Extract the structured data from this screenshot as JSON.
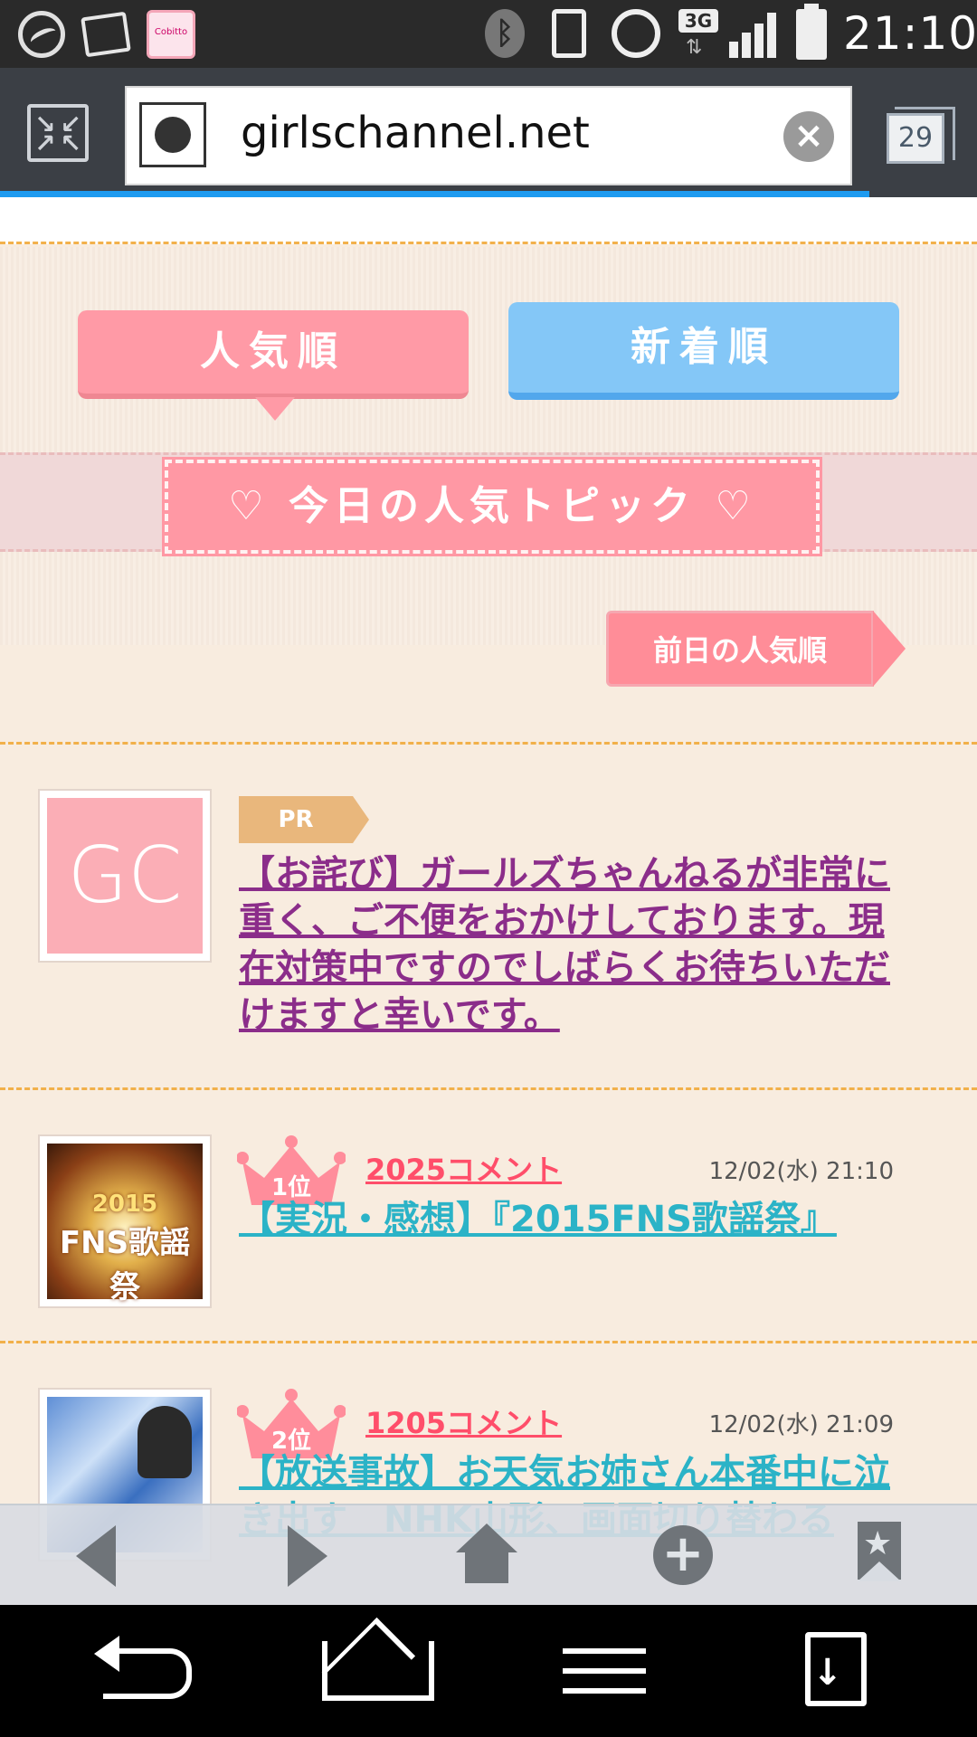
{
  "status_bar": {
    "time": "21:10",
    "network": "3G",
    "icons": [
      "app-launcher-icon",
      "photo-app-icon",
      "cobitto-app-icon",
      "bluetooth-icon",
      "vibrate-icon",
      "alarm-icon",
      "3g-icon",
      "signal-icon",
      "battery-icon"
    ],
    "app3_label": "Cobitto"
  },
  "address_bar": {
    "url": "girlschannel.net",
    "tab_count": "29",
    "progress": 0.89
  },
  "sort_tabs": {
    "popular_label": "人気順",
    "new_label": "新着順"
  },
  "section_title": "今日の人気トピック",
  "heart_glyph": "♡",
  "prev_day_label": "前日の人気順",
  "pr_item": {
    "badge": "PR",
    "thumb_text": "GC",
    "title": "【お詫び】ガールズちゃんねるが非常に重く、ご不便をおかけしております。現在対策中ですのでしばらくお待ちいただけますと幸いです。"
  },
  "topics": [
    {
      "rank_label": "1位",
      "comments": "2025コメント",
      "date": "12/02(水) 21:10",
      "title": "【実況・感想】『2015FNS歌謡祭』",
      "thumb_year": "2015",
      "thumb_text": "FNS歌謡祭"
    },
    {
      "rank_label": "2位",
      "comments": "1205コメント",
      "date": "12/02(水) 21:09",
      "title": "【放送事故】お天気お姉さん本番中に泣き出す　NHK山形、画面切り替わる"
    }
  ],
  "toolbar": {
    "back": "back-icon",
    "forward": "forward-icon",
    "home": "home-icon",
    "add": "add-icon",
    "bookmark": "bookmark-icon",
    "add_glyph": "+",
    "bookmark_glyph": "★"
  },
  "nav_bar": {
    "buttons": [
      "back-icon",
      "home-icon",
      "menu-icon",
      "download-icon"
    ],
    "download_glyph": "↓"
  },
  "colors": {
    "popular_tab": "#ff9aa6",
    "new_tab": "#84c7f7",
    "pr_link": "#8b2d8a",
    "topic_link": "#2bb3c7",
    "comment_count": "#ff4e6a",
    "progress": "#1e9bf0"
  }
}
